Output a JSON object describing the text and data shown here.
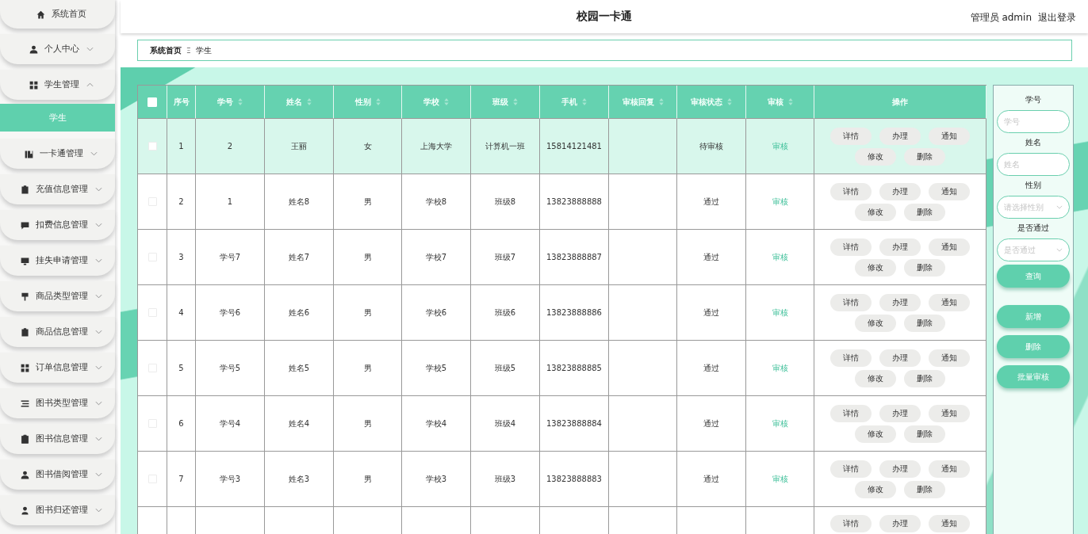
{
  "header": {
    "title": "校园一卡通",
    "user": "管理员 admin",
    "logout": "退出登录"
  },
  "sidebar": {
    "items": [
      {
        "label": "系统首页",
        "kind": "link"
      },
      {
        "label": "个人中心",
        "kind": "menu",
        "expanded": false
      },
      {
        "label": "学生管理",
        "kind": "menu",
        "expanded": true,
        "children": [
          {
            "label": "学生",
            "selected": true
          }
        ]
      },
      {
        "label": "一卡通管理",
        "kind": "menu",
        "expanded": false
      },
      {
        "label": "充值信息管理",
        "kind": "menu",
        "expanded": false
      },
      {
        "label": "扣费信息管理",
        "kind": "menu",
        "expanded": false
      },
      {
        "label": "挂失申请管理",
        "kind": "menu",
        "expanded": false
      },
      {
        "label": "商品类型管理",
        "kind": "menu",
        "expanded": false
      },
      {
        "label": "商品信息管理",
        "kind": "menu",
        "expanded": false
      },
      {
        "label": "订单信息管理",
        "kind": "menu",
        "expanded": false
      },
      {
        "label": "图书类型管理",
        "kind": "menu",
        "expanded": false
      },
      {
        "label": "图书信息管理",
        "kind": "menu",
        "expanded": false
      },
      {
        "label": "图书借阅管理",
        "kind": "menu",
        "expanded": false
      },
      {
        "label": "图书归还管理",
        "kind": "menu",
        "expanded": false
      }
    ]
  },
  "breadcrumb": {
    "items": [
      "系统首页",
      "学生"
    ],
    "separator": "Ξ"
  },
  "table": {
    "select_all": {
      "checked": false
    },
    "columns": [
      {
        "label": "序号",
        "sortable": false
      },
      {
        "label": "学号",
        "sortable": true
      },
      {
        "label": "姓名",
        "sortable": true
      },
      {
        "label": "性别",
        "sortable": true
      },
      {
        "label": "学校",
        "sortable": true
      },
      {
        "label": "班级",
        "sortable": true
      },
      {
        "label": "手机",
        "sortable": true
      },
      {
        "label": "审核回复",
        "sortable": true
      },
      {
        "label": "审核状态",
        "sortable": true
      },
      {
        "label": "审核",
        "sortable": true
      },
      {
        "label": "操作",
        "sortable": false
      }
    ],
    "rows": [
      {
        "checked": false,
        "hover": true,
        "cells": [
          "1",
          "2",
          "王丽",
          "女",
          "上海大学",
          "计算机一班",
          "15814121481"
        ],
        "status": "待审核",
        "review": "审核",
        "actions": [
          "详情",
          "办理",
          "通知",
          "修改",
          "删除"
        ]
      },
      {
        "checked": false,
        "hover": false,
        "cells": [
          "2",
          "1",
          "姓名8",
          "男",
          "学校8",
          "班级8",
          "13823888888"
        ],
        "status": "通过",
        "review": "审核",
        "actions": [
          "详情",
          "办理",
          "通知",
          "修改",
          "删除"
        ]
      },
      {
        "checked": false,
        "hover": false,
        "cells": [
          "3",
          "学号7",
          "姓名7",
          "男",
          "学校7",
          "班级7",
          "13823888887"
        ],
        "status": "通过",
        "review": "审核",
        "actions": [
          "详情",
          "办理",
          "通知",
          "修改",
          "删除"
        ]
      },
      {
        "checked": false,
        "hover": false,
        "cells": [
          "4",
          "学号6",
          "姓名6",
          "男",
          "学校6",
          "班级6",
          "13823888886"
        ],
        "status": "通过",
        "review": "审核",
        "actions": [
          "详情",
          "办理",
          "通知",
          "修改",
          "删除"
        ]
      },
      {
        "checked": false,
        "hover": false,
        "cells": [
          "5",
          "学号5",
          "姓名5",
          "男",
          "学校5",
          "班级5",
          "13823888885"
        ],
        "status": "通过",
        "review": "审核",
        "actions": [
          "详情",
          "办理",
          "通知",
          "修改",
          "删除"
        ]
      },
      {
        "checked": false,
        "hover": false,
        "cells": [
          "6",
          "学号4",
          "姓名4",
          "男",
          "学校4",
          "班级4",
          "13823888884"
        ],
        "status": "通过",
        "review": "审核",
        "actions": [
          "详情",
          "办理",
          "通知",
          "修改",
          "删除"
        ]
      },
      {
        "checked": false,
        "hover": false,
        "cells": [
          "7",
          "学号3",
          "姓名3",
          "男",
          "学校3",
          "班级3",
          "13823888883"
        ],
        "status": "通过",
        "review": "审核",
        "actions": [
          "详情",
          "办理",
          "通知",
          "修改",
          "删除"
        ]
      },
      {
        "hover": false,
        "actions": [
          "详情",
          "办理",
          "通知"
        ]
      }
    ]
  },
  "search": {
    "fields": [
      {
        "label": "学号",
        "kind": "input",
        "placeholder": "学号"
      },
      {
        "label": "姓名",
        "kind": "input",
        "placeholder": "姓名"
      },
      {
        "label": "性别",
        "kind": "select",
        "placeholder": "请选择性别"
      },
      {
        "label": "是否通过",
        "kind": "select",
        "placeholder": "是否通过"
      }
    ],
    "buttons": [
      "查询",
      "新增",
      "删除",
      "批量审核"
    ]
  }
}
